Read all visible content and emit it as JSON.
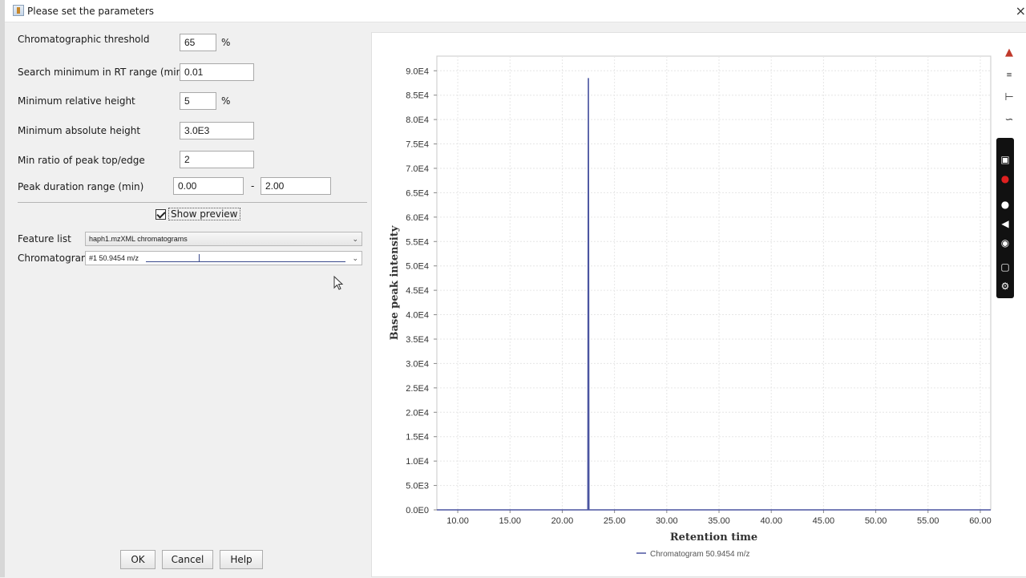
{
  "window": {
    "title": "Please set the parameters",
    "close_glyph": "×"
  },
  "params": {
    "chromatographic_threshold": {
      "label": "Chromatographic threshold",
      "value": "65",
      "unit": "%"
    },
    "search_minimum": {
      "label": "Search minimum in RT range (min)",
      "value": "0.01"
    },
    "min_relative_height": {
      "label": "Minimum relative height",
      "value": "5",
      "unit": "%"
    },
    "min_absolute_height": {
      "label": "Minimum absolute height",
      "value": "3.0E3"
    },
    "min_ratio": {
      "label": "Min ratio of peak top/edge",
      "value": "2"
    },
    "peak_duration": {
      "label": "Peak duration range (min)",
      "min": "0.00",
      "dash": "-",
      "max": "2.00"
    }
  },
  "preview": {
    "label": "Show preview",
    "checked": true
  },
  "feature_list": {
    "label": "Feature list",
    "value": "haph1.mzXML chromatograms"
  },
  "chromatogram": {
    "label": "Chromatogram",
    "value": "#1 50.9454 m/z"
  },
  "buttons": {
    "ok": "OK",
    "cancel": "Cancel",
    "help": "Help"
  },
  "chart_data": {
    "type": "line",
    "xlabel": "Retention time",
    "ylabel": "Base peak intensity",
    "xlim": [
      8.0,
      61.0
    ],
    "ylim": [
      0,
      93000
    ],
    "x_ticks": [
      "10.00",
      "15.00",
      "20.00",
      "25.00",
      "30.00",
      "35.00",
      "40.00",
      "45.00",
      "50.00",
      "55.00",
      "60.00"
    ],
    "y_ticks": [
      "0.0E0",
      "5.0E3",
      "1.0E4",
      "1.5E4",
      "2.0E4",
      "2.5E4",
      "3.0E4",
      "3.5E4",
      "4.0E4",
      "4.5E4",
      "5.0E4",
      "5.5E4",
      "6.0E4",
      "6.5E4",
      "7.0E4",
      "7.5E4",
      "8.0E4",
      "8.5E4",
      "9.0E4"
    ],
    "grid": true,
    "legend_position": "bottom",
    "series": [
      {
        "name": "Chromatogram 50.9454 m/z",
        "color": "#4a54a0",
        "x": [
          8.0,
          22.45,
          22.5,
          22.55,
          61.0
        ],
        "y": [
          0,
          0,
          88500,
          0,
          0
        ]
      }
    ]
  },
  "toolbar_icons": [
    "chart-icon",
    "data-icon",
    "axes-icon",
    "draw-icon"
  ],
  "recorder_icons": [
    "camera-icon",
    "record-icon",
    "microphone-icon",
    "speaker-icon",
    "webcam-icon",
    "window-icon",
    "settings-icon"
  ]
}
